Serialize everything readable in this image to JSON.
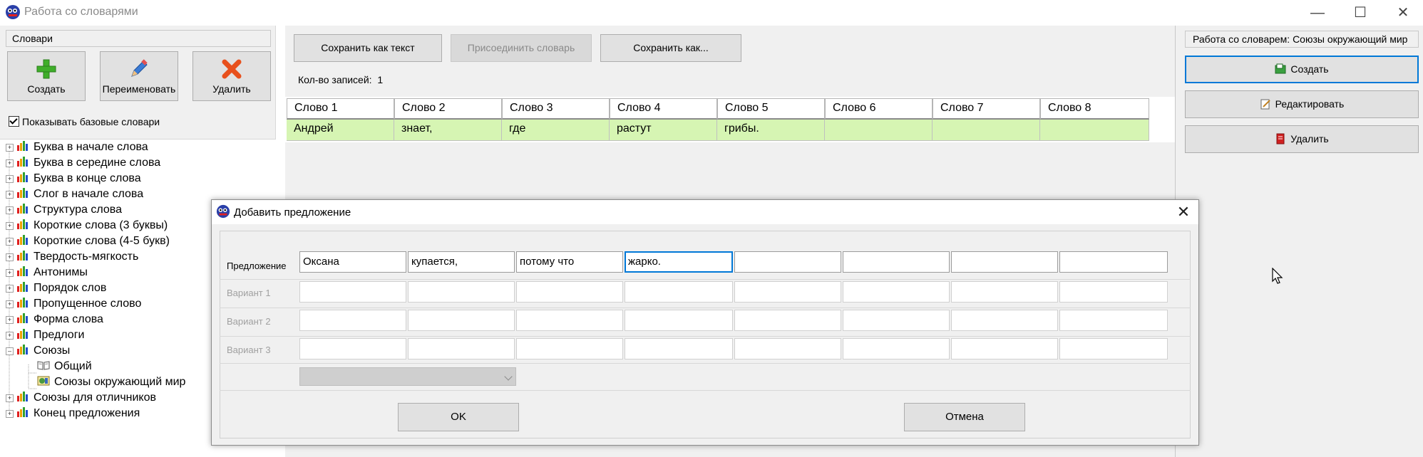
{
  "window": {
    "title": "Работа со словарями"
  },
  "left": {
    "dict_header": "Словари",
    "buttons": {
      "create": "Создать",
      "rename": "Переименовать",
      "delete": "Удалить"
    },
    "show_base": "Показывать базовые словари",
    "tree": [
      "Буква в начале слова",
      "Буква в середине слова",
      "Буква в конце слова",
      "Слог в начале слова",
      "Структура слова",
      "Короткие слова (3 буквы)",
      "Короткие слова (4-5 букв)",
      "Твердость-мягкость",
      "Антонимы",
      "Порядок слов",
      "Пропущенное слово",
      "Форма слова",
      "Предлоги",
      "Союзы",
      "Общий",
      "Союзы окружающий мир",
      "Союзы для отличников",
      "Конец предложения"
    ]
  },
  "center": {
    "toolbar": {
      "save_text": "Сохранить как текст",
      "attach": "Присоединить словарь",
      "save_as": "Сохранить как..."
    },
    "count_label": "Кол-во записей:",
    "count_value": "1",
    "columns": [
      "Слово 1",
      "Слово 2",
      "Слово 3",
      "Слово 4",
      "Слово 5",
      "Слово 6",
      "Слово 7",
      "Слово 8"
    ],
    "row": [
      "Андрей",
      "знает,",
      "где",
      "растут",
      "грибы.",
      "",
      "",
      ""
    ]
  },
  "right": {
    "header": "Работа со словарем: Союзы окружающий мир",
    "create": "Создать",
    "edit": "Редактировать",
    "delete": "Удалить"
  },
  "dialog": {
    "title": "Добавить предложение",
    "rows": [
      {
        "label": "Предложение",
        "values": [
          "Оксана",
          "купается,",
          "потому что",
          "жарко.",
          "",
          "",
          "",
          ""
        ]
      },
      {
        "label": "Вариант 1",
        "values": [
          "",
          "",
          "",
          "",
          "",
          "",
          "",
          ""
        ]
      },
      {
        "label": "Вариант 2",
        "values": [
          "",
          "",
          "",
          "",
          "",
          "",
          "",
          ""
        ]
      },
      {
        "label": "Вариант 3",
        "values": [
          "",
          "",
          "",
          "",
          "",
          "",
          "",
          ""
        ]
      }
    ],
    "ok": "OK",
    "cancel": "Отмена"
  }
}
